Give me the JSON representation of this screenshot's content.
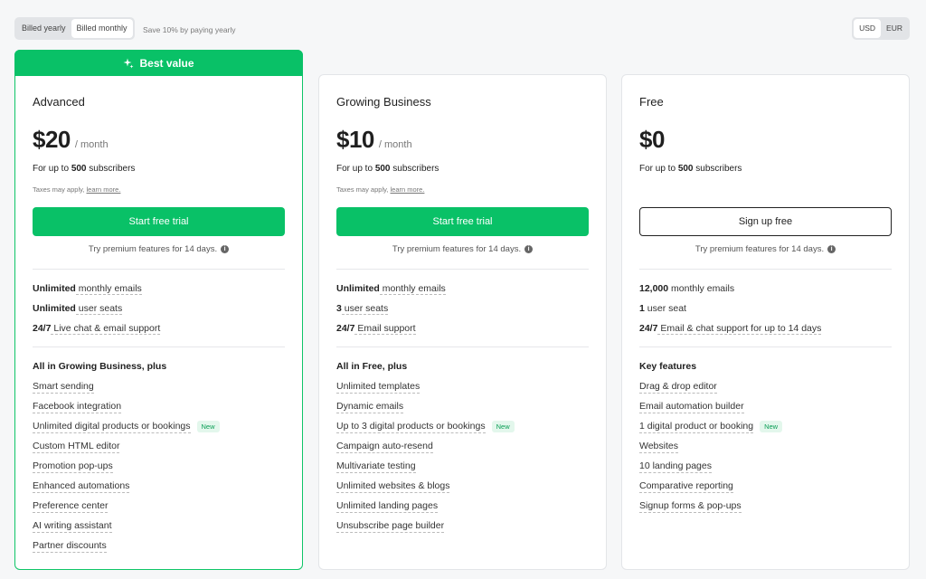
{
  "billing": {
    "yearly_label": "Billed yearly",
    "monthly_label": "Billed monthly",
    "active": "monthly",
    "save_note": "Save 10% by paying yearly"
  },
  "currency": {
    "usd": "USD",
    "eur": "EUR",
    "active": "USD"
  },
  "colors": {
    "accent": "#09c167",
    "badge_bg": "#e3f7ec",
    "badge_text": "#0a9e55"
  },
  "plans": [
    {
      "badge": "Best value",
      "name": "Advanced",
      "price": "$20",
      "per": "/ month",
      "subs_prefix": "For up to ",
      "subs_count": "500",
      "subs_suffix": " subscribers",
      "tax_prefix": "Taxes may apply, ",
      "tax_link": "learn more.",
      "cta": "Start free trial",
      "trial": "Try premium features for 14 days.",
      "limits": [
        {
          "bold": "Unlimited",
          "rest": " monthly emails"
        },
        {
          "bold": "Unlimited",
          "rest": " user seats"
        },
        {
          "bold": "24/7",
          "rest": " Live chat & email support"
        }
      ],
      "features_title": "All in Growing Business, plus",
      "features": [
        {
          "text": "Smart sending"
        },
        {
          "text": "Facebook integration"
        },
        {
          "text": "Unlimited digital products or bookings",
          "badge": "New"
        },
        {
          "text": "Custom HTML editor"
        },
        {
          "text": "Promotion pop-ups"
        },
        {
          "text": "Enhanced automations"
        },
        {
          "text": "Preference center"
        },
        {
          "text": "AI writing assistant"
        },
        {
          "text": "Partner discounts"
        }
      ]
    },
    {
      "name": "Growing Business",
      "price": "$10",
      "per": "/ month",
      "subs_prefix": "For up to ",
      "subs_count": "500",
      "subs_suffix": " subscribers",
      "tax_prefix": "Taxes may apply, ",
      "tax_link": "learn more.",
      "cta": "Start free trial",
      "trial": "Try premium features for 14 days.",
      "limits": [
        {
          "bold": "Unlimited",
          "rest": " monthly emails"
        },
        {
          "bold": "3",
          "rest": " user seats"
        },
        {
          "bold": "24/7",
          "rest": " Email support"
        }
      ],
      "features_title": "All in Free, plus",
      "features": [
        {
          "text": "Unlimited templates"
        },
        {
          "text": "Dynamic emails"
        },
        {
          "text": "Up to 3 digital products or bookings",
          "badge": "New"
        },
        {
          "text": "Campaign auto-resend"
        },
        {
          "text": "Multivariate testing"
        },
        {
          "text": "Unlimited websites & blogs"
        },
        {
          "text": "Unlimited landing pages"
        },
        {
          "text": "Unsubscribe page builder"
        }
      ]
    },
    {
      "name": "Free",
      "price": "$0",
      "per": "",
      "subs_prefix": "For up to ",
      "subs_count": "500",
      "subs_suffix": " subscribers",
      "cta": "Sign up free",
      "trial": "Try premium features for 14 days.",
      "limits": [
        {
          "bold": "12,000",
          "rest": " monthly emails"
        },
        {
          "bold": "1",
          "rest": " user seat"
        },
        {
          "bold": "24/7",
          "rest": " Email & chat support for up to 14 days"
        }
      ],
      "features_title": "Key features",
      "features": [
        {
          "text": "Drag & drop editor"
        },
        {
          "text": "Email automation builder"
        },
        {
          "text": "1 digital product or booking",
          "badge": "New"
        },
        {
          "text": "Websites"
        },
        {
          "text": "10 landing pages"
        },
        {
          "text": "Comparative reporting"
        },
        {
          "text": "Signup forms & pop-ups"
        }
      ]
    }
  ]
}
